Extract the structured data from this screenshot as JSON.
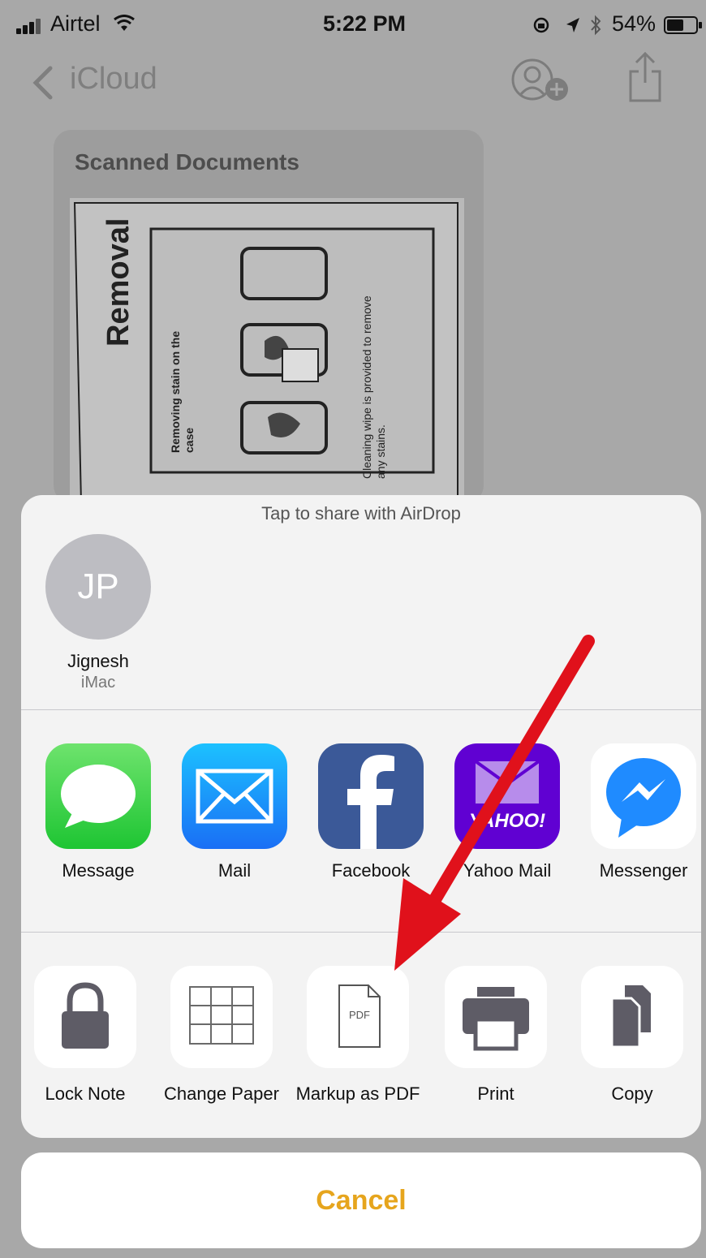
{
  "status_bar": {
    "carrier": "Airtel",
    "time": "5:22 PM",
    "battery": "54%"
  },
  "nav": {
    "back_label": "iCloud"
  },
  "note": {
    "title": "Scanned Documents"
  },
  "scan": {
    "heading": "Removal",
    "left_text": "Removing stain on the case",
    "right_text": "Cleaning wipe is provided to remove any stains."
  },
  "share_sheet": {
    "airdrop_hint": "Tap to share with AirDrop",
    "contact": {
      "initials": "JP",
      "name": "Jignesh",
      "device": "iMac"
    },
    "apps": [
      {
        "label": "Message",
        "icon": "message-icon",
        "color": "#34c759"
      },
      {
        "label": "Mail",
        "icon": "mail-icon",
        "color": "#1e8ff5"
      },
      {
        "label": "Facebook",
        "icon": "facebook-icon",
        "color": "#3b5998"
      },
      {
        "label": "Yahoo Mail",
        "icon": "yahoo-mail-icon",
        "color": "#6001d2",
        "logo": "YAHOO!"
      },
      {
        "label": "Messenger",
        "icon": "messenger-icon",
        "color": "#1f8bff"
      }
    ],
    "actions": [
      {
        "label": "Lock Note",
        "icon": "lock-icon"
      },
      {
        "label": "Change Paper",
        "icon": "grid-paper-icon"
      },
      {
        "label": "Markup as PDF",
        "icon": "pdf-icon",
        "icon_text": "PDF"
      },
      {
        "label": "Print",
        "icon": "printer-icon"
      },
      {
        "label": "Copy",
        "icon": "copy-icon"
      }
    ]
  },
  "cancel_label": "Cancel",
  "annotation": {
    "color": "#e0111b"
  }
}
